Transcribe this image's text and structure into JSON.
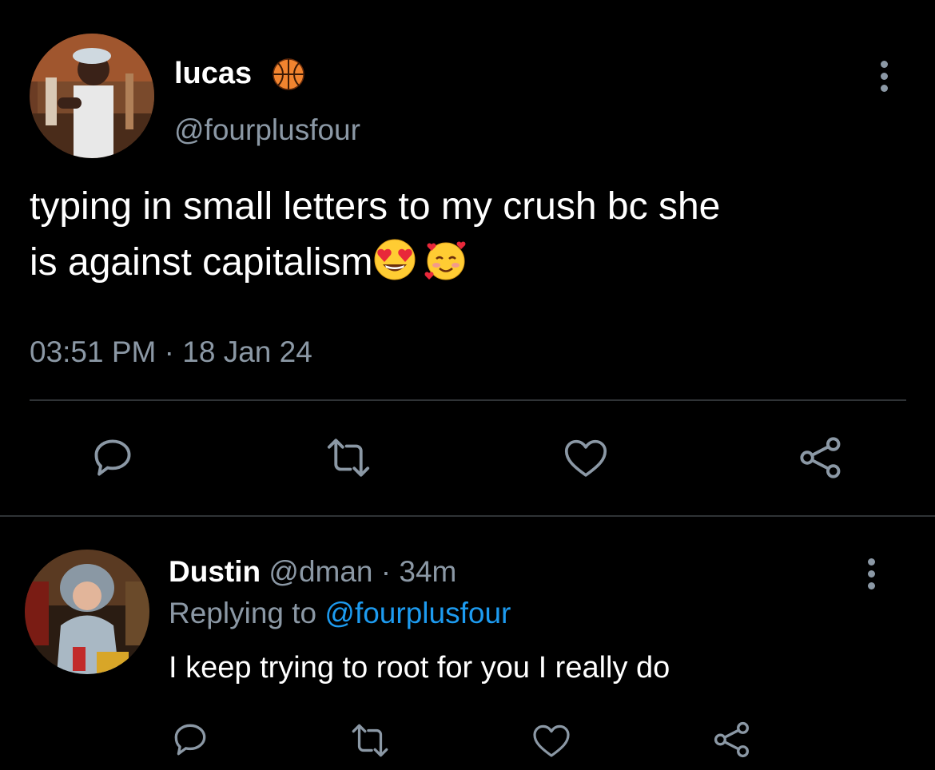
{
  "main_tweet": {
    "author_name": "lucas",
    "author_badge_icon": "basketball-emoji",
    "author_handle": "@fourplusfour",
    "text_line1": "typing in small letters to my crush bc she",
    "text_line2": "is against capitalism",
    "text_emojis": [
      "heart-eyes-emoji",
      "smiling-face-with-hearts-emoji"
    ],
    "time": "03:51 PM",
    "separator": "·",
    "date": "18 Jan 24",
    "actions": [
      "reply-icon",
      "retweet-icon",
      "like-icon",
      "share-icon"
    ]
  },
  "reply": {
    "author_name": "Dustin",
    "author_handle": "@dman",
    "separator": "·",
    "time_ago": "34m",
    "replying_label": "Replying to",
    "replying_to": "@fourplusfour",
    "text": "I keep trying to root for you I really do",
    "actions": [
      "reply-icon",
      "retweet-icon",
      "like-icon",
      "share-icon"
    ]
  },
  "colors": {
    "background": "#000000",
    "primary_text": "#ffffff",
    "secondary_text": "#8b98a5",
    "link": "#1d9bf0",
    "divider": "#2f3336"
  }
}
